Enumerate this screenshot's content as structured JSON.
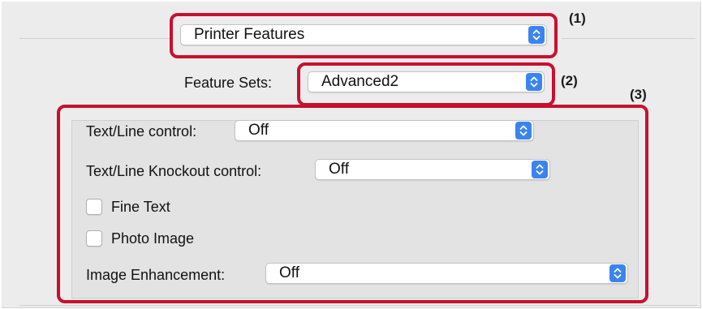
{
  "panel_select": {
    "value": "Printer Features"
  },
  "feature_sets": {
    "label": "Feature Sets:",
    "value": "Advanced2"
  },
  "options": {
    "text_line_control": {
      "label": "Text/Line control:",
      "value": "Off"
    },
    "text_line_knockout": {
      "label": "Text/Line Knockout control:",
      "value": "Off"
    },
    "fine_text": {
      "label": "Fine Text",
      "checked": false
    },
    "photo_image": {
      "label": "Photo Image",
      "checked": false
    },
    "image_enhancement": {
      "label": "Image Enhancement:",
      "value": "Off"
    }
  },
  "callouts": [
    "(1)",
    "(2)",
    "(3)"
  ],
  "colors": {
    "callout_border": "#c8102e",
    "stepper_accent": "#3b84f0",
    "dialog_background": "#ececec"
  },
  "icons": {
    "popup_arrows": "chevron-up-down-icon"
  }
}
